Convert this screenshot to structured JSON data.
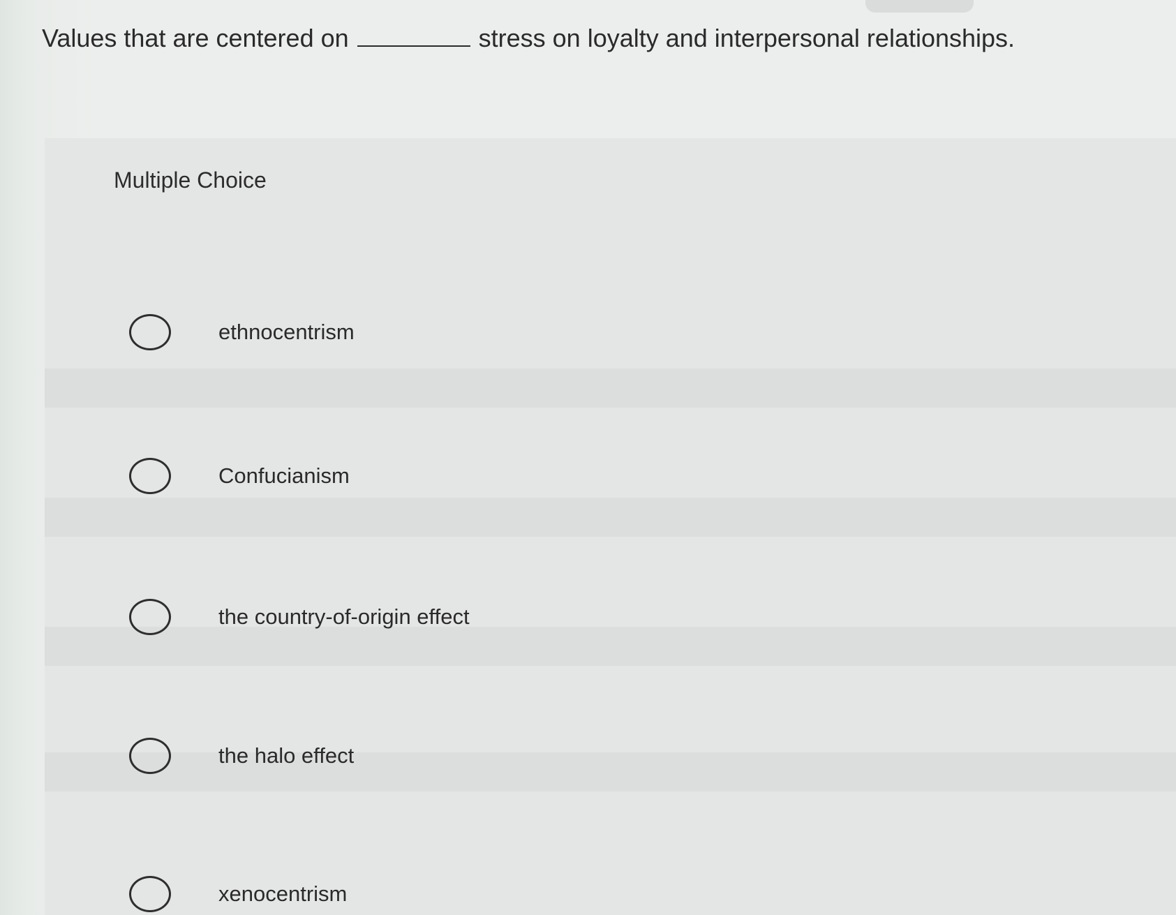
{
  "question": {
    "text_before": "Values that are centered on",
    "text_after": "stress on loyalty and interpersonal relationships."
  },
  "question_type": "Multiple Choice",
  "options": [
    {
      "label": "ethnocentrism",
      "selected": false
    },
    {
      "label": "Confucianism",
      "selected": false
    },
    {
      "label": "the country-of-origin effect",
      "selected": false
    },
    {
      "label": "the halo effect",
      "selected": false
    },
    {
      "label": "xenocentrism",
      "selected": false
    }
  ]
}
